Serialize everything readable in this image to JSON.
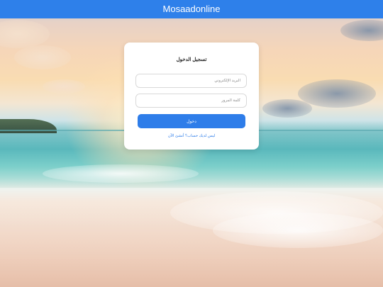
{
  "header": {
    "title": "Mosaadonline"
  },
  "login": {
    "title": "تسجيل الدخول",
    "email_placeholder": "البريد الإلكتروني",
    "password_placeholder": "كلمة المرور",
    "submit_label": "دخول",
    "register_link": "ليس لديك حساب؟ أنشئ الآن"
  },
  "theme": {
    "accent": "#2e7de9",
    "header_bg": "#2e80ea"
  }
}
